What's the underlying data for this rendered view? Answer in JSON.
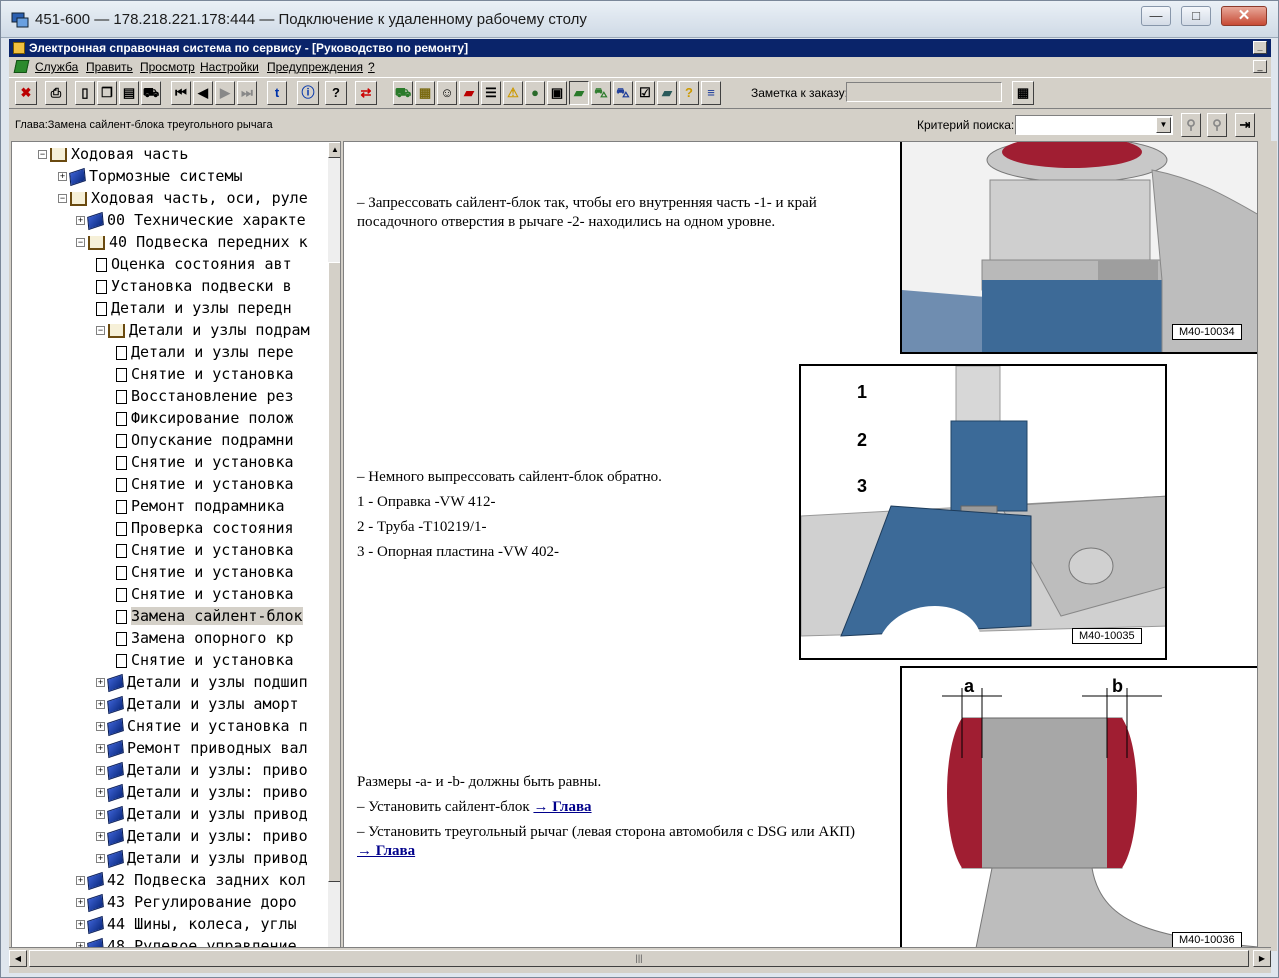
{
  "rdp": {
    "title": "451-600 — 178.218.221.178:444 — Подключение к удаленному рабочему столу",
    "min": "—",
    "max": "□",
    "close": "✕"
  },
  "app": {
    "title": "Электронная справочная система по сервису - [Руководство по ремонту]"
  },
  "menu": [
    "Служба",
    "Править",
    "Просмотр",
    "Настройки",
    "Предупреждения",
    "?"
  ],
  "toolbar": {
    "note_label": "Заметка к заказу:"
  },
  "chapter": "Глава:Замена сайлент-блока треугольного рычага",
  "search": {
    "label": "Критерий поиска:"
  },
  "tree": [
    {
      "label": "Ходовая часть",
      "icon": "open"
    },
    {
      "label": "Тормозные системы",
      "icon": "book"
    },
    {
      "label": "Ходовая часть, оси, руле",
      "icon": "open"
    },
    {
      "label": "00 Технические характе",
      "icon": "book"
    },
    {
      "label": "40 Подвеска передних к",
      "icon": "open"
    },
    {
      "label": "Оценка состояния авт",
      "icon": "doc"
    },
    {
      "label": "Установка подвески в",
      "icon": "doc"
    },
    {
      "label": "Детали и узлы передн",
      "icon": "doc"
    },
    {
      "label": "Детали и узлы подрам",
      "icon": "open"
    },
    {
      "label": "Детали и узлы пере",
      "icon": "doc"
    },
    {
      "label": "Снятие и установка",
      "icon": "doc"
    },
    {
      "label": "Восстановление рез",
      "icon": "doc"
    },
    {
      "label": "Фиксирование полож",
      "icon": "doc"
    },
    {
      "label": "Опускание подрамни",
      "icon": "doc"
    },
    {
      "label": "Снятие и установка",
      "icon": "doc"
    },
    {
      "label": "Снятие и установка",
      "icon": "doc"
    },
    {
      "label": "Ремонт подрамника",
      "icon": "doc"
    },
    {
      "label": "Проверка состояния",
      "icon": "doc"
    },
    {
      "label": "Снятие и установка",
      "icon": "doc"
    },
    {
      "label": "Снятие и установка",
      "icon": "doc"
    },
    {
      "label": "Снятие и установка",
      "icon": "doc"
    },
    {
      "label": "Замена сайлент-блок",
      "icon": "doc",
      "selected": true
    },
    {
      "label": "Замена опорного кр",
      "icon": "doc"
    },
    {
      "label": "Снятие и установка",
      "icon": "doc"
    },
    {
      "label": "Детали и узлы подшип",
      "icon": "book"
    },
    {
      "label": "Детали и узлы аморт",
      "icon": "book"
    },
    {
      "label": "Снятие и установка п",
      "icon": "book"
    },
    {
      "label": "Ремонт приводных вал",
      "icon": "book"
    },
    {
      "label": "Детали и узлы: приво",
      "icon": "book"
    },
    {
      "label": "Детали и узлы: приво",
      "icon": "book"
    },
    {
      "label": "Детали и узлы привод",
      "icon": "book"
    },
    {
      "label": "Детали и узлы: приво",
      "icon": "book"
    },
    {
      "label": "Детали и узлы привод",
      "icon": "book"
    },
    {
      "label": "42 Подвеска задних кол",
      "icon": "book"
    },
    {
      "label": "43 Регулирование доро",
      "icon": "book"
    },
    {
      "label": "44 Шины, колеса, углы",
      "icon": "book"
    },
    {
      "label": "48 Рулевое управление",
      "icon": "book"
    }
  ],
  "content": {
    "step1": "– Запрессовать сайлент-блок так, чтобы его внутренняя часть -1- и край посадочного отверстия в рычаге -2- находились на одном уровне.",
    "step2": "– Немного выпрессовать сайлент-блок обратно.",
    "item1": "1 -  Оправка -VW 412-",
    "item2": "2 -  Труба -T10219/1-",
    "item3": "3 -  Опорная пластина -VW 402-",
    "sizes": "Размеры -a- и -b- должны быть равны.",
    "step3": "– Установить сайлент-блок ",
    "step4": "– Установить треугольный рычаг (левая сторона автомобиля с DSG или АКП) ",
    "link": "→ Глава",
    "fig1": "M40-10034",
    "fig2": "M40-10035",
    "fig3": "M40-10036",
    "c1": "1",
    "c2": "2",
    "c3": "3",
    "ca": "a",
    "cb": "b"
  }
}
